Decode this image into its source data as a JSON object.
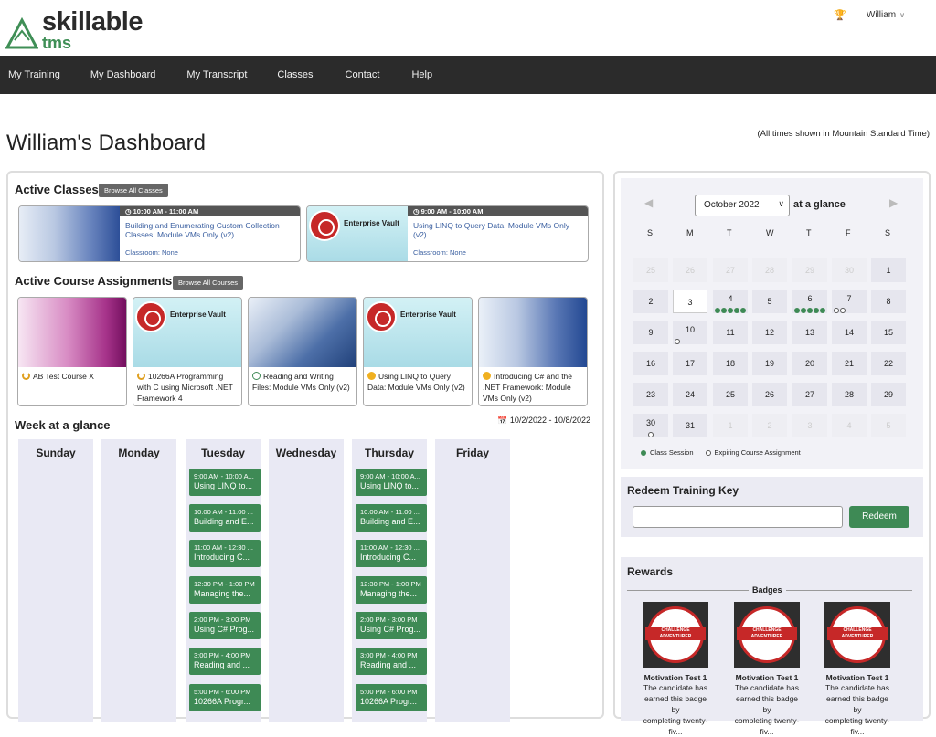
{
  "brand": {
    "logo_word1": "skillable",
    "logo_word2": "tms",
    "accent": "#3e8a55"
  },
  "user": {
    "name": "William"
  },
  "nav": [
    "My Training",
    "My Dashboard",
    "My Transcript",
    "Classes",
    "Contact",
    "Help"
  ],
  "page": {
    "title": "William's Dashboard",
    "timezone_note": "(All times shown in Mountain Standard Time)"
  },
  "active_classes": {
    "heading": "Active Classes",
    "browse_label": "Browse All Classes",
    "items": [
      {
        "time": "10:00 AM - 11:00 AM",
        "title": "Building and Enumerating Custom Collection Classes: Module VMs Only (v2)",
        "room": "Classroom: None",
        "thumb": "blue"
      },
      {
        "time": "9:00 AM - 10:00 AM",
        "title": "Using LINQ to Query Data: Module VMs Only (v2)",
        "room": "Classroom: None",
        "thumb": "enterprise-vault"
      }
    ]
  },
  "course_assignments": {
    "heading": "Active Course Assignments",
    "browse_label": "Browse All Courses",
    "items": [
      {
        "title": "AB Test Course X",
        "status": "in-progress"
      },
      {
        "title": "10266A Programming with C using Microsoft .NET Framework 4",
        "status": "in-progress"
      },
      {
        "title": "Reading and Writing Files: Module VMs Only (v2)",
        "status": "completed"
      },
      {
        "title": "Using LINQ to Query Data: Module VMs Only (v2)",
        "status": "badge"
      },
      {
        "title": "Introducing C# and the .NET Framework: Module VMs Only (v2)",
        "status": "badge"
      }
    ],
    "enterprise_vault_label": "Enterprise Vault"
  },
  "week": {
    "heading": "Week at a glance",
    "range": "10/2/2022 - 10/8/2022",
    "days": [
      "Sunday",
      "Monday",
      "Tuesday",
      "Wednesday",
      "Thursday",
      "Friday"
    ],
    "tuesday": [
      {
        "time": "9:00 AM - 10:00 A...",
        "title": "Using LINQ to..."
      },
      {
        "time": "10:00 AM - 11:00 ...",
        "title": "Building and E..."
      },
      {
        "time": "11:00 AM - 12:30 ...",
        "title": "Introducing C..."
      },
      {
        "time": "12:30 PM - 1:00 PM",
        "title": "Managing the..."
      },
      {
        "time": "2:00 PM - 3:00 PM",
        "title": "Using C# Prog..."
      },
      {
        "time": "3:00 PM - 4:00 PM",
        "title": "Reading and ..."
      },
      {
        "time": "5:00 PM - 6:00 PM",
        "title": "10266A Progr..."
      }
    ],
    "thursday": [
      {
        "time": "9:00 AM - 10:00 A...",
        "title": "Using LINQ to..."
      },
      {
        "time": "10:00 AM - 11:00 ...",
        "title": "Building and E..."
      },
      {
        "time": "11:00 AM - 12:30 ...",
        "title": "Introducing C..."
      },
      {
        "time": "12:30 PM - 1:00 PM",
        "title": "Managing the..."
      },
      {
        "time": "2:00 PM - 3:00 PM",
        "title": "Using C# Prog..."
      },
      {
        "time": "3:00 PM - 4:00 PM",
        "title": "Reading and ..."
      },
      {
        "time": "5:00 PM - 6:00 PM",
        "title": "10266A Progr..."
      }
    ]
  },
  "calendar": {
    "month_select": "October 2022",
    "at_a_glance": "at a glance",
    "weekday_headers": [
      "S",
      "M",
      "T",
      "W",
      "T",
      "F",
      "S"
    ],
    "weeks": [
      [
        "25",
        "26",
        "27",
        "28",
        "29",
        "30",
        "1"
      ],
      [
        "2",
        "3",
        "4",
        "5",
        "6",
        "7",
        "8"
      ],
      [
        "9",
        "10",
        "11",
        "12",
        "13",
        "14",
        "15"
      ],
      [
        "16",
        "17",
        "18",
        "19",
        "20",
        "21",
        "22"
      ],
      [
        "23",
        "24",
        "25",
        "26",
        "27",
        "28",
        "29"
      ],
      [
        "30",
        "31",
        "1",
        "2",
        "3",
        "4",
        "5"
      ]
    ],
    "legend_class": "Class Session",
    "legend_expiring": "Expiring Course Assignment"
  },
  "redeem": {
    "heading": "Redeem Training Key",
    "input_value": "",
    "button_label": "Redeem"
  },
  "rewards": {
    "heading": "Rewards",
    "badges_heading": "Badges",
    "badge_band_text": "CHALLENGE ADVENTURER",
    "badges": [
      {
        "name": "Motivation Test 1",
        "desc1": "The candidate has",
        "desc2": "earned this badge by",
        "desc3": "completing twenty-fiv..."
      },
      {
        "name": "Motivation Test 1",
        "desc1": "The candidate has",
        "desc2": "earned this badge by",
        "desc3": "completing twenty-fiv..."
      },
      {
        "name": "Motivation Test 1",
        "desc1": "The candidate has",
        "desc2": "earned this badge by",
        "desc3": "completing twenty-fiv..."
      }
    ]
  }
}
